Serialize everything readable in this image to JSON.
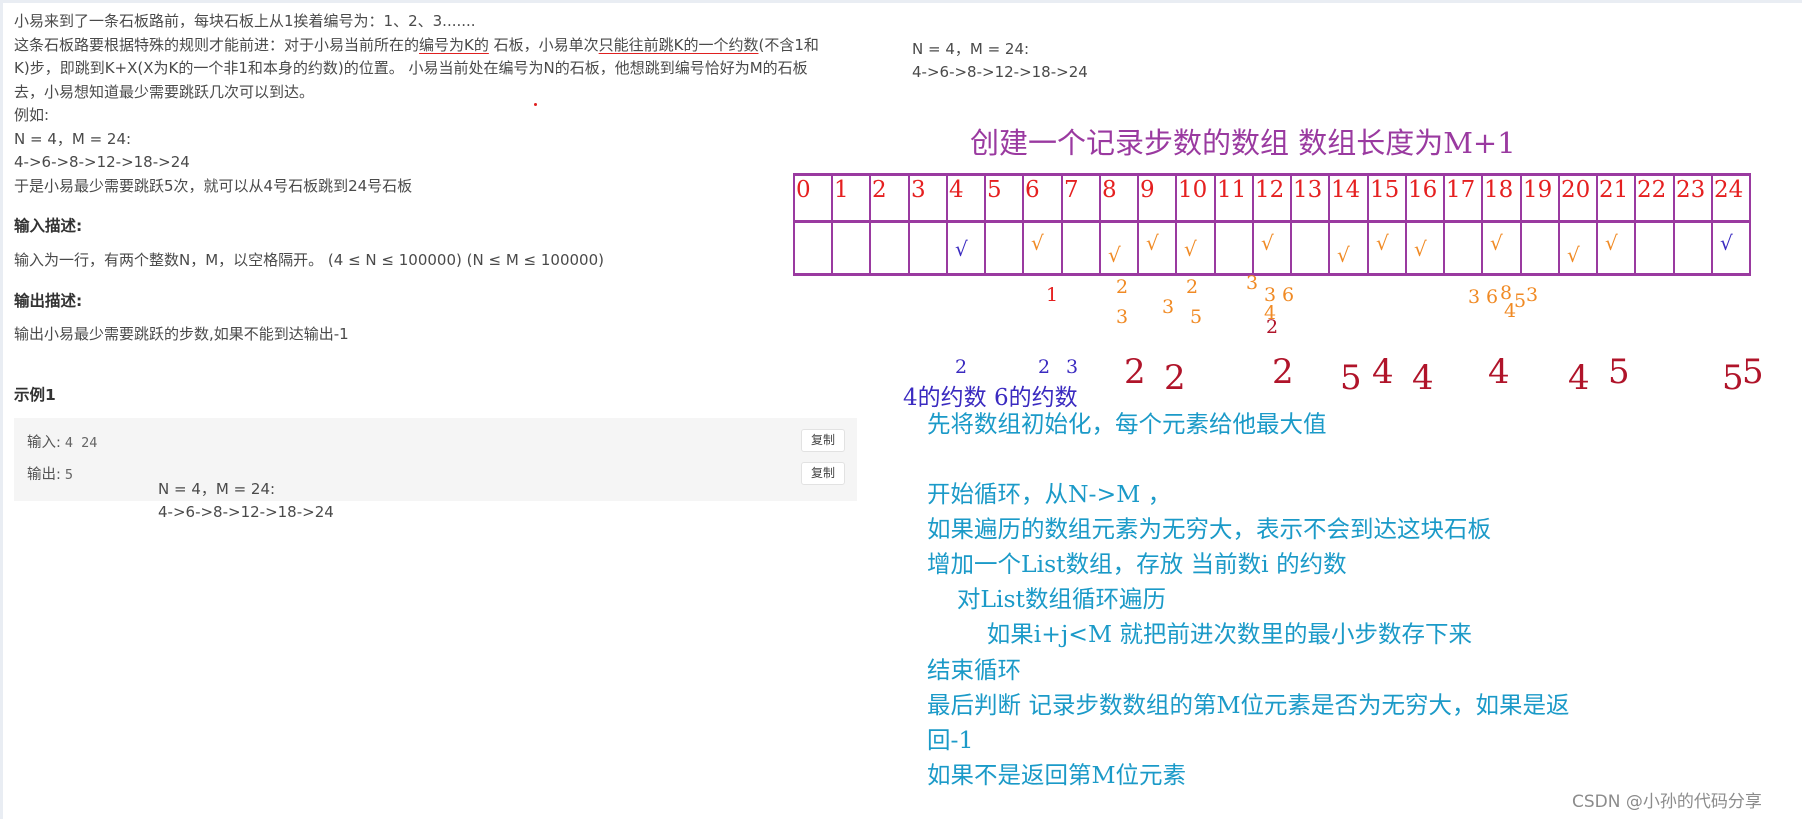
{
  "problem": {
    "line1": "小易来到了一条石板路前，每块石板上从1挨着编号为：1、2、3.......",
    "line2_a": "这条石板路要根据特殊的规则才能前进：对于小易当前所在的",
    "line2_b": "编号为K的",
    "line2_c": " 石板，小易单次",
    "line2_d": "只能往前跳K的一个约数",
    "line2_e": "(不含1和",
    "line3": "K)步，即跳到K+X(X为K的一个非1和本身的约数)的位置。 小易当前处在编号为N的石板，他想跳到编号恰好为M的石板",
    "line4": "去，小易想知道最少需要跳跃几次可以到达。",
    "line5": "例如:",
    "line6": "N = 4，M = 24:",
    "line7": "4->6->8->12->18->24",
    "line8": "于是小易最少需要跳跃5次，就可以从4号石板跳到24号石板"
  },
  "input_desc": {
    "title": "输入描述:",
    "text": "输入为一行，有两个整数N，M，以空格隔开。 (4 ≤ N ≤ 100000) (N ≤ M ≤ 100000)"
  },
  "output_desc": {
    "title": "输出描述:",
    "text": "输出小易最少需要跳跃的步数,如果不能到达输出-1"
  },
  "example": {
    "title": "示例1",
    "input_label": "输入:",
    "input_value": "4 24",
    "output_label": "输出:",
    "output_value": "5",
    "copy_label": "复制"
  },
  "note_left": {
    "line1": "N = 4，M = 24:",
    "line2": "4->6->8->12->18->24"
  },
  "note_right": {
    "line1": "N = 4，M = 24:",
    "line2": "4->6->8->12->18->24"
  },
  "annotation": {
    "heading": "创建一个记录步数的数组  数组长度为M+1",
    "indices": [
      "0",
      "1",
      "2",
      "3",
      "4",
      "5",
      "6",
      "7",
      "8",
      "9",
      "10",
      "11",
      "12",
      "13",
      "14",
      "15",
      "16",
      "17",
      "18",
      "19",
      "20",
      "21",
      "22",
      "23",
      "24"
    ],
    "divisor_label": "4的约数 6的约数",
    "steps_row": [
      "2",
      "2",
      "2",
      "5",
      "4",
      "4",
      "4",
      "4",
      "5",
      "5",
      "5"
    ],
    "divisor_marks": [
      "1",
      "2",
      "3",
      "3",
      "2",
      "5",
      "3",
      "3",
      "4",
      "6",
      "2",
      "3",
      "6",
      "8",
      "4",
      "5",
      "3"
    ],
    "colors": {
      "purple": "#9a3aa0",
      "red": "#e52020",
      "blue": "#1b9ac8",
      "orange": "#f08a24",
      "darkred": "#b0142a"
    }
  },
  "steps": [
    "先将数组初始化，每个元素给他最大值",
    "",
    "开始循环，从N->M ，",
    "如果遍历的数组元素为无穷大，表示不会到达这块石板",
    "增加一个List数组，存放 当前数i 的约数",
    "    对List数组循环遍历",
    "        如果i+j<M 就把前进次数里的最小步数存下来",
    "结束循环",
    "最后判断 记录步数数组的第M位元素是否为无穷大，如果是返",
    "回-1",
    "如果不是返回第M位元素"
  ],
  "watermark": "CSDN @小孙的代码分享"
}
